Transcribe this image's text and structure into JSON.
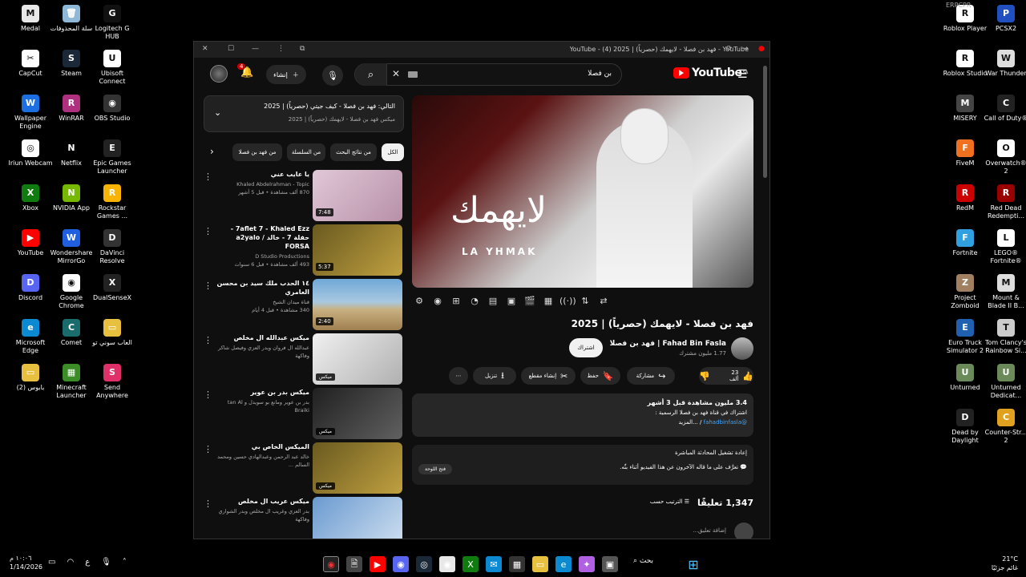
{
  "desktop_left": [
    {
      "label": "Medal",
      "color": "#e8e8e8",
      "glyph": "M"
    },
    {
      "label": "سلة المحذوفات",
      "color": "#8fb8d8",
      "glyph": "🗑"
    },
    {
      "label": "Logitech G HUB",
      "color": "#111",
      "glyph": "G"
    },
    {
      "label": "CapCut",
      "color": "#fff",
      "glyph": "✂"
    },
    {
      "label": "Steam",
      "color": "#1b2838",
      "glyph": "S"
    },
    {
      "label": "Ubisoft Connect",
      "color": "#fff",
      "glyph": "U"
    },
    {
      "label": "Wallpaper Engine",
      "color": "#1c6fe0",
      "glyph": "W"
    },
    {
      "label": "WinRAR",
      "color": "#b03080",
      "glyph": "R"
    },
    {
      "label": "OBS Studio",
      "color": "#333",
      "glyph": "◉"
    },
    {
      "label": "Iriun Webcam",
      "color": "#fff",
      "glyph": "◎"
    },
    {
      "label": "Netflix",
      "color": "#000",
      "glyph": "N"
    },
    {
      "label": "Epic Games Launcher",
      "color": "#222",
      "glyph": "E"
    },
    {
      "label": "Xbox",
      "color": "#107c10",
      "glyph": "X"
    },
    {
      "label": "NVIDIA App",
      "color": "#76b900",
      "glyph": "N"
    },
    {
      "label": "Rockstar Games ...",
      "color": "#f8b400",
      "glyph": "R"
    },
    {
      "label": "YouTube",
      "color": "#f00",
      "glyph": "▶"
    },
    {
      "label": "Wondershare MirrorGo",
      "color": "#2060e0",
      "glyph": "W"
    },
    {
      "label": "DaVinci Resolve",
      "color": "#333",
      "glyph": "D"
    },
    {
      "label": "Discord",
      "color": "#5865f2",
      "glyph": "D"
    },
    {
      "label": "Google Chrome",
      "color": "#fff",
      "glyph": "◉"
    },
    {
      "label": "DualSenseX",
      "color": "#222",
      "glyph": "X"
    },
    {
      "label": "Microsoft Edge",
      "color": "#0c8ad1",
      "glyph": "e"
    },
    {
      "label": "Comet",
      "color": "#1a6b6b",
      "glyph": "C"
    },
    {
      "label": "العاب سوني تو",
      "color": "#e8c040",
      "glyph": "▭"
    },
    {
      "label": "(2) بابوس",
      "color": "#e8c040",
      "glyph": "▭"
    },
    {
      "label": "Minecraft Launcher",
      "color": "#3c8c28",
      "glyph": "▦"
    },
    {
      "label": "Send Anywhere",
      "color": "#e0306a",
      "glyph": "S"
    }
  ],
  "desktop_right": [
    {
      "label": "Roblox Player",
      "color": "#fff",
      "glyph": "R"
    },
    {
      "label": "PCSX2",
      "color": "#2050c0",
      "glyph": "P"
    },
    {
      "label": "Roblox Studio",
      "color": "#fff",
      "glyph": "R"
    },
    {
      "label": "War Thunder",
      "color": "#ddd",
      "glyph": "W"
    },
    {
      "label": "MISERY",
      "color": "#444",
      "glyph": "M"
    },
    {
      "label": "Call of Duty®",
      "color": "#222",
      "glyph": "C"
    },
    {
      "label": "FiveM",
      "color": "#f07020",
      "glyph": "F"
    },
    {
      "label": "Overwatch® 2",
      "color": "#fff",
      "glyph": "O"
    },
    {
      "label": "RedM",
      "color": "#c00",
      "glyph": "R"
    },
    {
      "label": "Red Dead Redempti...",
      "color": "#900",
      "glyph": "R"
    },
    {
      "label": "Fortnite",
      "color": "#30a0e0",
      "glyph": "F"
    },
    {
      "label": "LEGO® Fortnite®",
      "color": "#fff",
      "glyph": "L"
    },
    {
      "label": "Project Zomboid",
      "color": "#a08060",
      "glyph": "Z"
    },
    {
      "label": "Mount & Blade II B...",
      "color": "#ddd",
      "glyph": "M"
    },
    {
      "label": "Euro Truck Simulator 2",
      "color": "#2060b0",
      "glyph": "E"
    },
    {
      "label": "Tom Clancy's Rainbow Si...",
      "color": "#ccc",
      "glyph": "T"
    },
    {
      "label": "Unturned",
      "color": "#6a8a5a",
      "glyph": "U"
    },
    {
      "label": "Unturned Dedicat...",
      "color": "#6a8a5a",
      "glyph": "U"
    },
    {
      "label": "Dead by Daylight",
      "color": "#222",
      "glyph": "D"
    },
    {
      "label": "Counter-Str... 2",
      "color": "#e0a020",
      "glyph": "C"
    }
  ],
  "erpc_label": "ERPCPR",
  "window": {
    "title": "YouTube - فهد بن فصلا - لايهمك (حصرياً) | 2025 (4) - YouTube",
    "search_query": "بن فصلا",
    "create_label": "إنشاء",
    "notif_count": "4",
    "logo_text": "YouTube",
    "logo_region": "SA"
  },
  "video": {
    "overlay_arabic": "لايهمك",
    "overlay_latin": "LA YHMAK",
    "title": "فهد بن فصلا - لايهمك (حصرياً) | 2025",
    "channel_name": "Fahad Bin Fasla | فهد بن فصلا",
    "subscribers": "1.77 مليون مشترك",
    "subscribe_label": "اشتراك",
    "likes": "23 ألف",
    "share_label": "مشاركة",
    "save_label": "حفظ",
    "clip_label": "إنشاء مقطع",
    "download_label": "تنزيل"
  },
  "description": {
    "stats": "3.4 مليون مشاهدة قبل 3 أشهر",
    "line2": "اشتراك في قناة فهد بن فصلا الرسمية :",
    "handle": "@fahadbinfasla",
    "more": "...المزيد"
  },
  "livechat": {
    "title": "إعادة تشغيل المحادثة المباشرة",
    "body": "تعرَّف على ما قاله الآخرون عن هذا الفيديو أثناء بثّه.",
    "button": "فتح اللوحة"
  },
  "comments": {
    "count": "1,347 تعليقًا",
    "sort_label": "الترتيب حسب",
    "add_placeholder": "إضافة تعليق..."
  },
  "queue": {
    "line1": "التالي: فهد بن فصلا - كيف جيتي (حصرياً) | 2025",
    "line2": "ميكس فهد بن فصلا - لايهمك (حصرياً) | 2025"
  },
  "chips": [
    {
      "label": "الكل",
      "selected": true
    },
    {
      "label": "من نتائج البحث",
      "selected": false
    },
    {
      "label": "من السلسلة",
      "selected": false
    },
    {
      "label": "من فهد بن فصلا",
      "selected": false
    }
  ],
  "recs": [
    {
      "title": "يا عايب عني",
      "channel": "Khaled Abdelrahman - Topic",
      "meta": "870 ألف مشاهدة • قبل 5 أشهر",
      "dur": "7:48",
      "bg": "linear-gradient(135deg,#e0c8d8,#b890a8)",
      "mix": ""
    },
    {
      "title": "7aflet 7 - Khaled Ezz - حفلة 7 - خالد / a2yalo FORSA",
      "channel": "D Studio Productions",
      "meta": "493 ألف مشاهدة • قبل 6 سنوات",
      "dur": "5:37",
      "bg": "linear-gradient(135deg,#6a5a20,#c0a040)",
      "mix": ""
    },
    {
      "title": "١٤ الحدب ملك سيد بن محسن العامري",
      "channel": "قناة ميدان الشيخ",
      "meta": "340 مشاهدة • قبل 4 أيام",
      "dur": "2:40",
      "bg": "linear-gradient(#6fa8d8 0%,#a8c8e0 45%,#c8b080 60%,#a08050 100%)",
      "mix": ""
    },
    {
      "title": "ميكس عبدالله ال مخلص",
      "channel": "عبدالله ال فروان وبدر العزي وفيصل شاكر وفاكهة",
      "meta": "",
      "dur": "",
      "bg": "linear-gradient(135deg,#f0f0f0,#b0b0b0)",
      "mix": "ميكس"
    },
    {
      "title": "ميكس بدر بن عوير",
      "channel": "بدر بن عوير ومانع بو سويدل و tan Al Braiki",
      "meta": "",
      "dur": "",
      "bg": "linear-gradient(135deg,#202020,#606060)",
      "mix": "ميكس"
    },
    {
      "title": "الميكس الخاص بي",
      "channel": "خالد عبد الرحمن وعبدالهادي حسين ومحمد السالم ...",
      "meta": "",
      "dur": "",
      "bg": "linear-gradient(135deg,#6a5a20,#c0a040)",
      "mix": "ميكس"
    },
    {
      "title": "ميكس عريب ال مخلص",
      "channel": "بدر العزي وغريب ال مخلص وبدر الشواري وفاكهة",
      "meta": "",
      "dur": "",
      "bg": "linear-gradient(135deg,#6a9ad0,#d0e0f0)",
      "mix": ""
    }
  ],
  "taskbar": {
    "time": "١٠:٠٦ م",
    "date": "1/14/2026",
    "search_label": "بحث",
    "temp": "21°C",
    "weather": "غائم جزئيًا"
  }
}
